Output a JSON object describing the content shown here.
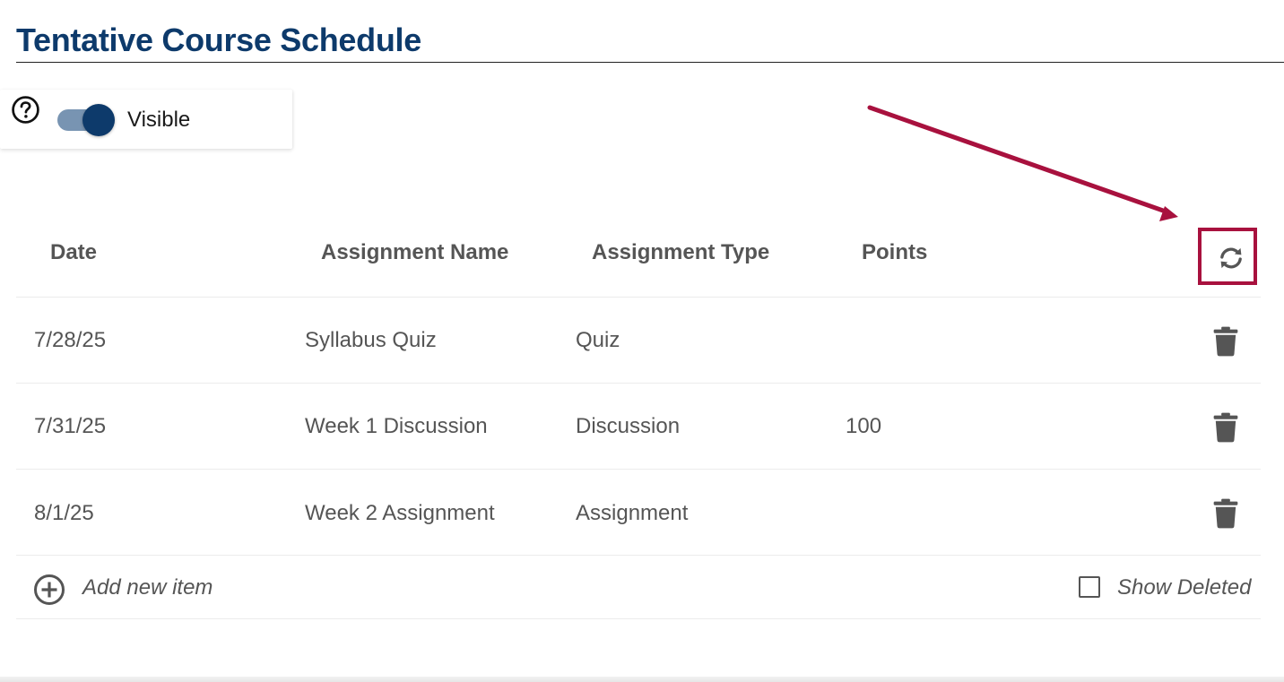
{
  "page": {
    "title": "Tentative Course Schedule"
  },
  "visibility": {
    "label": "Visible",
    "enabled": true
  },
  "table": {
    "columns": [
      "Date",
      "Assignment Name",
      "Assignment Type",
      "Points"
    ],
    "rows": [
      {
        "date": "7/28/25",
        "name": "Syllabus Quiz",
        "type": "Quiz",
        "points": ""
      },
      {
        "date": "7/31/25",
        "name": "Week 1 Discussion",
        "type": "Discussion",
        "points": "100"
      },
      {
        "date": "8/1/25",
        "name": "Week 2 Assignment",
        "type": "Assignment",
        "points": ""
      }
    ]
  },
  "footer": {
    "add_label": "Add new item",
    "show_deleted_label": "Show Deleted",
    "show_deleted_checked": false
  },
  "colors": {
    "brand": "#0d3a6b",
    "annotation": "#a8113e",
    "text": "#555555"
  },
  "icons": [
    "help-icon",
    "toggle-switch",
    "sync-icon",
    "trash-icon",
    "add-circle-icon",
    "checkbox-icon"
  ]
}
